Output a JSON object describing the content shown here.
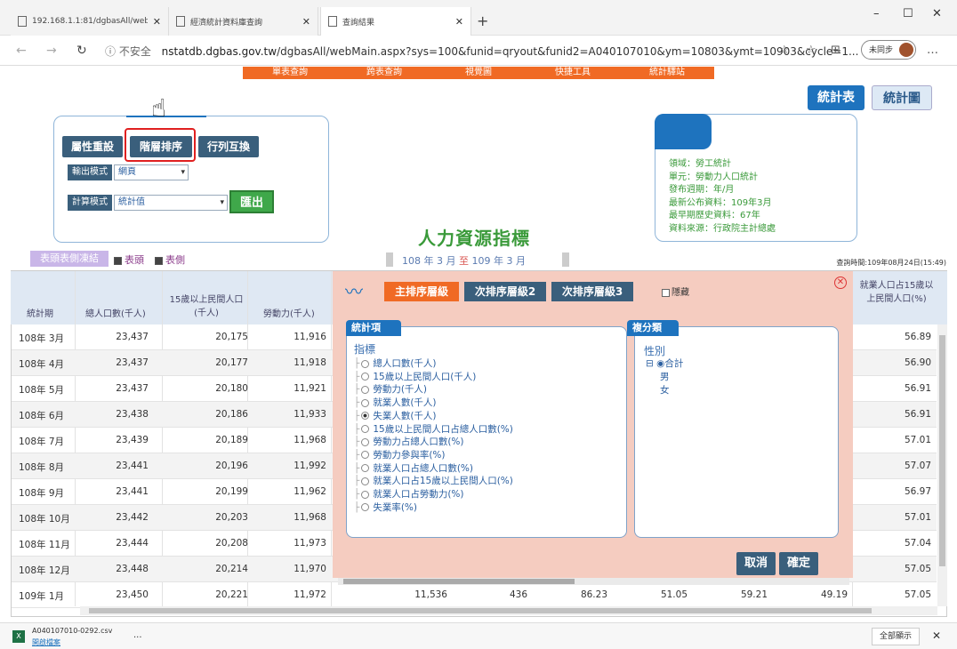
{
  "browser": {
    "tabs": [
      {
        "title": "192.168.1.1:81/dgbasAll/webMa",
        "active": false
      },
      {
        "title": "經濟統計資料庫查詢",
        "active": false
      },
      {
        "title": "查詢結果",
        "active": true
      }
    ],
    "new_tab": "+",
    "url_insecure": "ⓘ 不安全",
    "url_host": "nstatdb.dgbas.gov.tw",
    "url_path": "/dgbasAll/webMain.aspx?sys=100&funid=qryout&funid2=A040107010&ym=10803&ymt=10903&cycle=1...",
    "profile_label": "未同步",
    "window_controls": [
      "–",
      "☐",
      "✕"
    ]
  },
  "top_nav": [
    "單表查詢",
    "跨表查詢",
    "視覺圖",
    "快捷工具",
    "統計驛站"
  ],
  "view_toggle": {
    "table": "統計表",
    "chart": "統計圖"
  },
  "controls": {
    "reset_attr": "屬性重設",
    "level_sort": "階層排序",
    "swap_rows_cols": "行列互換",
    "output_label": "輸出模式",
    "output_value": "網頁",
    "calc_label": "計算模式",
    "calc_value": "統計值",
    "export": "匯出"
  },
  "info": {
    "lines": [
      "領域：勞工統計",
      "單元：勞動力人口統計",
      "發布週期：年/月",
      "最新公布資料：109年3月",
      "最早期歷史資料：67年",
      "資料來源：行政院主計總處"
    ]
  },
  "title": "人力資源指標",
  "period": {
    "from": "108 年 3 月",
    "to_word": "至",
    "to": "109 年 3 月"
  },
  "query_time": "查詢時間:109年08月24日(15:49)",
  "freeze": {
    "label": "表頭表側凍結",
    "header": "表頭",
    "side": "表側"
  },
  "table": {
    "headers": [
      "統計期",
      "總人口數(千人)",
      "15歲以上民間人口(千人)",
      "勞動力(千人)",
      "就業人口占15歲以上民間人口(%)"
    ],
    "rows": [
      {
        "period": "108年 3月",
        "c1": "23,437",
        "c2": "20,175",
        "c3": "11,916",
        "last": "56.89"
      },
      {
        "period": "108年 4月",
        "c1": "23,437",
        "c2": "20,177",
        "c3": "11,918",
        "last": "56.90"
      },
      {
        "period": "108年 5月",
        "c1": "23,437",
        "c2": "20,180",
        "c3": "11,921",
        "last": "56.91"
      },
      {
        "period": "108年 6月",
        "c1": "23,438",
        "c2": "20,186",
        "c3": "11,933",
        "last": "56.91"
      },
      {
        "period": "108年 7月",
        "c1": "23,439",
        "c2": "20,189",
        "c3": "11,968",
        "last": "57.01"
      },
      {
        "period": "108年 8月",
        "c1": "23,441",
        "c2": "20,196",
        "c3": "11,992",
        "last": "57.07"
      },
      {
        "period": "108年 9月",
        "c1": "23,441",
        "c2": "20,199",
        "c3": "11,962",
        "last": "56.97"
      },
      {
        "period": "108年 10月",
        "c1": "23,442",
        "c2": "20,203",
        "c3": "11,968",
        "last": "57.01"
      },
      {
        "period": "108年 11月",
        "c1": "23,444",
        "c2": "20,208",
        "c3": "11,973",
        "last": "57.04"
      },
      {
        "period": "108年 12月",
        "c1": "23,448",
        "c2": "20,214",
        "c3": "11,970",
        "last": "57.05"
      },
      {
        "period": "109年 1月",
        "c1": "23,450",
        "c2": "20,221",
        "c3": "11,972",
        "last": "57.05"
      }
    ],
    "last_row_extra": [
      "11,536",
      "436",
      "86.23",
      "51.05",
      "59.21",
      "49.19"
    ]
  },
  "sort_dialog": {
    "tabs": [
      "主排序層級",
      "次排序層級2",
      "次排序層級3"
    ],
    "filter": "隱藏",
    "stat_header": "統計項",
    "stat_root": "指標",
    "stat_items": [
      {
        "label": "總人口數(千人)",
        "selected": false
      },
      {
        "label": "15歲以上民間人口(千人)",
        "selected": false
      },
      {
        "label": "勞動力(千人)",
        "selected": false
      },
      {
        "label": "就業人數(千人)",
        "selected": false
      },
      {
        "label": "失業人數(千人)",
        "selected": true
      },
      {
        "label": "15歲以上民間人口占總人口數(%)",
        "selected": false
      },
      {
        "label": "勞動力占總人口數(%)",
        "selected": false
      },
      {
        "label": "勞動力參與率(%)",
        "selected": false
      },
      {
        "label": "就業人口占總人口數(%)",
        "selected": false
      },
      {
        "label": "就業人口占15歲以上民間人口(%)",
        "selected": false
      },
      {
        "label": "就業人口占勞動力(%)",
        "selected": false
      },
      {
        "label": "失業率(%)",
        "selected": false
      }
    ],
    "class_header": "複分類",
    "class_root": "性別",
    "class_items": [
      "合計",
      "男",
      "女"
    ],
    "cancel": "取消",
    "confirm": "確定"
  },
  "download": {
    "file": "A040107010-0292.csv",
    "open": "開啟檔案",
    "more": "...",
    "show_all": "全部顯示",
    "close": "✕"
  }
}
